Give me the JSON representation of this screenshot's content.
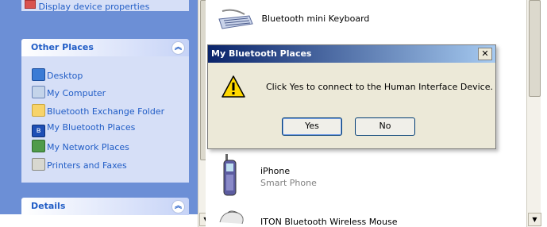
{
  "taskpane": {
    "prev_item_label": "Display device properties",
    "other_places": {
      "title": "Other Places",
      "items": [
        {
          "label": "Desktop",
          "icon": "desktop-icon"
        },
        {
          "label": "My Computer",
          "icon": "computer-icon"
        },
        {
          "label": "Bluetooth Exchange Folder",
          "icon": "folder-icon"
        },
        {
          "label": "My Bluetooth Places",
          "icon": "bluetooth-icon"
        },
        {
          "label": "My Network Places",
          "icon": "network-icon"
        },
        {
          "label": "Printers and Faxes",
          "icon": "printer-icon"
        }
      ]
    },
    "details": {
      "title": "Details"
    }
  },
  "devices": [
    {
      "name": "Bluetooth mini Keyboard",
      "icon": "keyboard-icon"
    },
    {
      "name": "iPhone",
      "type": "Smart Phone",
      "icon": "phone-icon"
    },
    {
      "name": "ITON Bluetooth Wireless Mouse",
      "icon": "mouse-icon"
    }
  ],
  "dialog": {
    "title": "My Bluetooth Places",
    "message": "Click Yes to connect to the Human Interface Device.",
    "yes_label": "Yes",
    "no_label": "No",
    "close_glyph": "✕",
    "icon": "warning-icon"
  },
  "colors": {
    "taskpane_bg": "#6c8fd6",
    "panel_bg": "#d6dff7",
    "link": "#215dc6",
    "dialog_title": "#0a246a"
  }
}
